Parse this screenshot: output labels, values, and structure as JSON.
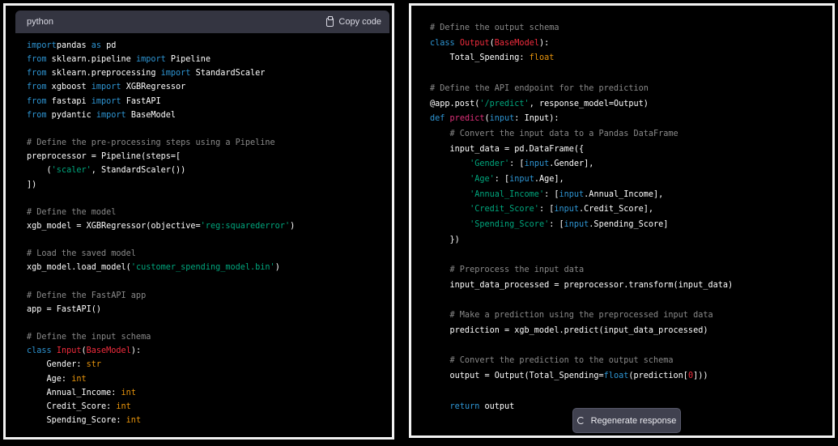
{
  "left": {
    "language": "python",
    "copy_label": "Copy code",
    "lines": [
      [
        [
          "k",
          "import"
        ],
        [
          "",
          "pandas "
        ],
        [
          "k",
          "as"
        ],
        [
          "",
          " pd"
        ]
      ],
      [
        [
          "k",
          "from"
        ],
        [
          "",
          " sklearn.pipeline "
        ],
        [
          "k",
          "import"
        ],
        [
          "",
          " Pipeline"
        ]
      ],
      [
        [
          "k",
          "from"
        ],
        [
          "",
          " sklearn.preprocessing "
        ],
        [
          "k",
          "import"
        ],
        [
          "",
          " StandardScaler"
        ]
      ],
      [
        [
          "k",
          "from"
        ],
        [
          "",
          " xgboost "
        ],
        [
          "k",
          "import"
        ],
        [
          "",
          " XGBRegressor"
        ]
      ],
      [
        [
          "k",
          "from"
        ],
        [
          "",
          " fastapi "
        ],
        [
          "k",
          "import"
        ],
        [
          "",
          " FastAPI"
        ]
      ],
      [
        [
          "k",
          "from"
        ],
        [
          "",
          " pydantic "
        ],
        [
          "k",
          "import"
        ],
        [
          "",
          " BaseModel"
        ]
      ],
      [],
      [
        [
          "c",
          "# Define the pre-processing steps using a Pipeline"
        ]
      ],
      [
        [
          "",
          "preprocessor = Pipeline(steps=["
        ]
      ],
      [
        [
          "",
          "    ("
        ],
        [
          "s",
          "'scaler'"
        ],
        [
          "",
          ", StandardScaler())"
        ]
      ],
      [
        [
          "",
          "])"
        ]
      ],
      [],
      [
        [
          "c",
          "# Define the model"
        ]
      ],
      [
        [
          "",
          "xgb_model = XGBRegressor(objective="
        ],
        [
          "s",
          "'reg:squarederror'"
        ],
        [
          "",
          ")"
        ]
      ],
      [],
      [
        [
          "c",
          "# Load the saved model"
        ]
      ],
      [
        [
          "",
          "xgb_model.load_model("
        ],
        [
          "s",
          "'customer_spending_model.bin'"
        ],
        [
          "",
          ")"
        ]
      ],
      [],
      [
        [
          "c",
          "# Define the FastAPI app"
        ]
      ],
      [
        [
          "",
          "app = FastAPI()"
        ]
      ],
      [],
      [
        [
          "c",
          "# Define the input schema"
        ]
      ],
      [
        [
          "k",
          "class"
        ],
        [
          "",
          " "
        ],
        [
          "t",
          "Input"
        ],
        [
          "",
          "("
        ],
        [
          "t",
          "BaseModel"
        ],
        [
          "",
          "):"
        ]
      ],
      [
        [
          "",
          "    Gender: "
        ],
        [
          "ty",
          "str"
        ]
      ],
      [
        [
          "",
          "    Age: "
        ],
        [
          "ty",
          "int"
        ]
      ],
      [
        [
          "",
          "    Annual_Income: "
        ],
        [
          "ty",
          "int"
        ]
      ],
      [
        [
          "",
          "    Credit_Score: "
        ],
        [
          "ty",
          "int"
        ]
      ],
      [
        [
          "",
          "    Spending_Score: "
        ],
        [
          "ty",
          "int"
        ]
      ]
    ]
  },
  "right": {
    "lines": [
      [
        [
          "c",
          "# Define the output schema"
        ]
      ],
      [
        [
          "k",
          "class"
        ],
        [
          "",
          " "
        ],
        [
          "t",
          "Output"
        ],
        [
          "",
          "("
        ],
        [
          "t",
          "BaseModel"
        ],
        [
          "",
          "):"
        ]
      ],
      [
        [
          "",
          "    Total_Spending: "
        ],
        [
          "ty",
          "float"
        ]
      ],
      [],
      [
        [
          "c",
          "# Define the API endpoint for the prediction"
        ]
      ],
      [
        [
          "",
          "@app.post("
        ],
        [
          "s",
          "'/predict'"
        ],
        [
          "",
          ", response_model=Output)"
        ]
      ],
      [
        [
          "k",
          "def"
        ],
        [
          "",
          " "
        ],
        [
          "f",
          "predict"
        ],
        [
          "",
          "("
        ],
        [
          "k",
          "input"
        ],
        [
          "",
          ": Input):"
        ]
      ],
      [
        [
          "c",
          "    # Convert the input data to a Pandas DataFrame"
        ]
      ],
      [
        [
          "",
          "    input_data = pd.DataFrame({"
        ]
      ],
      [
        [
          "",
          "        "
        ],
        [
          "s",
          "'Gender'"
        ],
        [
          "",
          ": ["
        ],
        [
          "k",
          "input"
        ],
        [
          "",
          ".Gender],"
        ]
      ],
      [
        [
          "",
          "        "
        ],
        [
          "s",
          "'Age'"
        ],
        [
          "",
          ": ["
        ],
        [
          "k",
          "input"
        ],
        [
          "",
          ".Age],"
        ]
      ],
      [
        [
          "",
          "        "
        ],
        [
          "s",
          "'Annual_Income'"
        ],
        [
          "",
          ": ["
        ],
        [
          "k",
          "input"
        ],
        [
          "",
          ".Annual_Income],"
        ]
      ],
      [
        [
          "",
          "        "
        ],
        [
          "s",
          "'Credit_Score'"
        ],
        [
          "",
          ": ["
        ],
        [
          "k",
          "input"
        ],
        [
          "",
          ".Credit_Score],"
        ]
      ],
      [
        [
          "",
          "        "
        ],
        [
          "s",
          "'Spending_Score'"
        ],
        [
          "",
          ": ["
        ],
        [
          "k",
          "input"
        ],
        [
          "",
          ".Spending_Score]"
        ]
      ],
      [
        [
          "",
          "    })"
        ]
      ],
      [],
      [
        [
          "c",
          "    # Preprocess the input data"
        ]
      ],
      [
        [
          "",
          "    input_data_processed = preprocessor.transform(input_data)"
        ]
      ],
      [],
      [
        [
          "c",
          "    # Make a prediction using the preprocessed input data"
        ]
      ],
      [
        [
          "",
          "    prediction = xgb_model.predict(input_data_processed)"
        ]
      ],
      [],
      [
        [
          "c",
          "    # Convert the prediction to the output schema"
        ]
      ],
      [
        [
          "",
          "    output = Output(Total_Spending="
        ],
        [
          "k",
          "float"
        ],
        [
          "",
          "(prediction["
        ],
        [
          "t",
          "0"
        ],
        [
          "",
          "]))"
        ]
      ],
      [],
      [
        [
          "",
          "    "
        ],
        [
          "k",
          "return"
        ],
        [
          "",
          " output"
        ]
      ]
    ],
    "regenerate_label": "Regenerate response"
  }
}
